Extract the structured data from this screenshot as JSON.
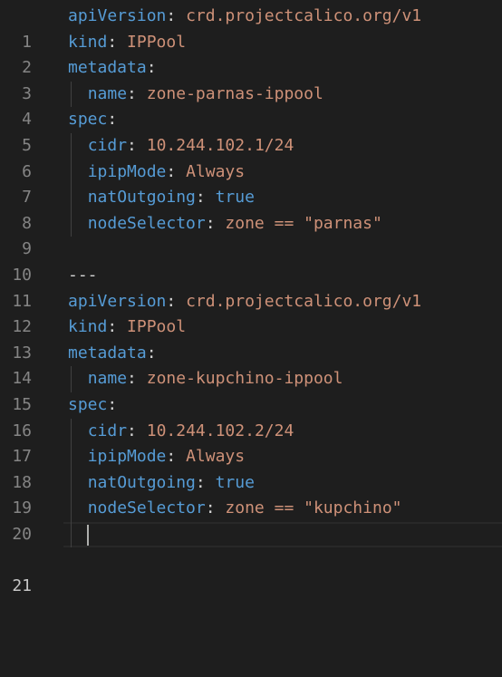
{
  "editor": {
    "language": "yaml",
    "current_line": 21,
    "colors": {
      "background": "#1e1e1e",
      "key": "#569cd6",
      "string": "#ce9178",
      "boolean": "#569cd6",
      "punctuation": "#d4d4d4",
      "line_number": "#858585",
      "line_number_active": "#c6c6c6"
    },
    "lines": [
      {
        "num": "1",
        "key": "apiVersion",
        "sep": ":",
        "value": "crd.projectcalico.org/v1",
        "vtype": "string"
      },
      {
        "num": "2",
        "key": "kind",
        "sep": ":",
        "value": "IPPool",
        "vtype": "string"
      },
      {
        "num": "3",
        "key": "metadata",
        "sep": ":",
        "value": "",
        "vtype": "string"
      },
      {
        "num": "4",
        "key": "name",
        "sep": ":",
        "value": "zone-parnas-ippool",
        "vtype": "string"
      },
      {
        "num": "5",
        "key": "spec",
        "sep": ":",
        "value": "",
        "vtype": "string"
      },
      {
        "num": "6",
        "key": "cidr",
        "sep": ":",
        "value": "10.244.102.1/24",
        "vtype": "string"
      },
      {
        "num": "7",
        "key": "ipipMode",
        "sep": ":",
        "value": "Always",
        "vtype": "string"
      },
      {
        "num": "8",
        "key": "natOutgoing",
        "sep": ":",
        "value": "true",
        "vtype": "boolean"
      },
      {
        "num": "9",
        "key": "nodeSelector",
        "sep": ":",
        "value": "zone == \"parnas\"",
        "vtype": "string"
      },
      {
        "num": "10",
        "key": "",
        "sep": "",
        "value": "",
        "vtype": "string"
      },
      {
        "num": "11",
        "key": "",
        "sep": "",
        "value": "---",
        "vtype": "punct"
      },
      {
        "num": "12",
        "key": "apiVersion",
        "sep": ":",
        "value": "crd.projectcalico.org/v1",
        "vtype": "string"
      },
      {
        "num": "13",
        "key": "kind",
        "sep": ":",
        "value": "IPPool",
        "vtype": "string"
      },
      {
        "num": "14",
        "key": "metadata",
        "sep": ":",
        "value": "",
        "vtype": "string"
      },
      {
        "num": "15",
        "key": "name",
        "sep": ":",
        "value": "zone-kupchino-ippool",
        "vtype": "string"
      },
      {
        "num": "16",
        "key": "spec",
        "sep": ":",
        "value": "",
        "vtype": "string"
      },
      {
        "num": "17",
        "key": "cidr",
        "sep": ":",
        "value": "10.244.102.2/24",
        "vtype": "string"
      },
      {
        "num": "18",
        "key": "ipipMode",
        "sep": ":",
        "value": "Always",
        "vtype": "string"
      },
      {
        "num": "19",
        "key": "natOutgoing",
        "sep": ":",
        "value": "true",
        "vtype": "boolean"
      },
      {
        "num": "20",
        "key": "nodeSelector",
        "sep": ":",
        "value": "zone == \"kupchino\"",
        "vtype": "string"
      },
      {
        "num": "21",
        "key": "",
        "sep": "",
        "value": "",
        "vtype": "string"
      }
    ]
  }
}
